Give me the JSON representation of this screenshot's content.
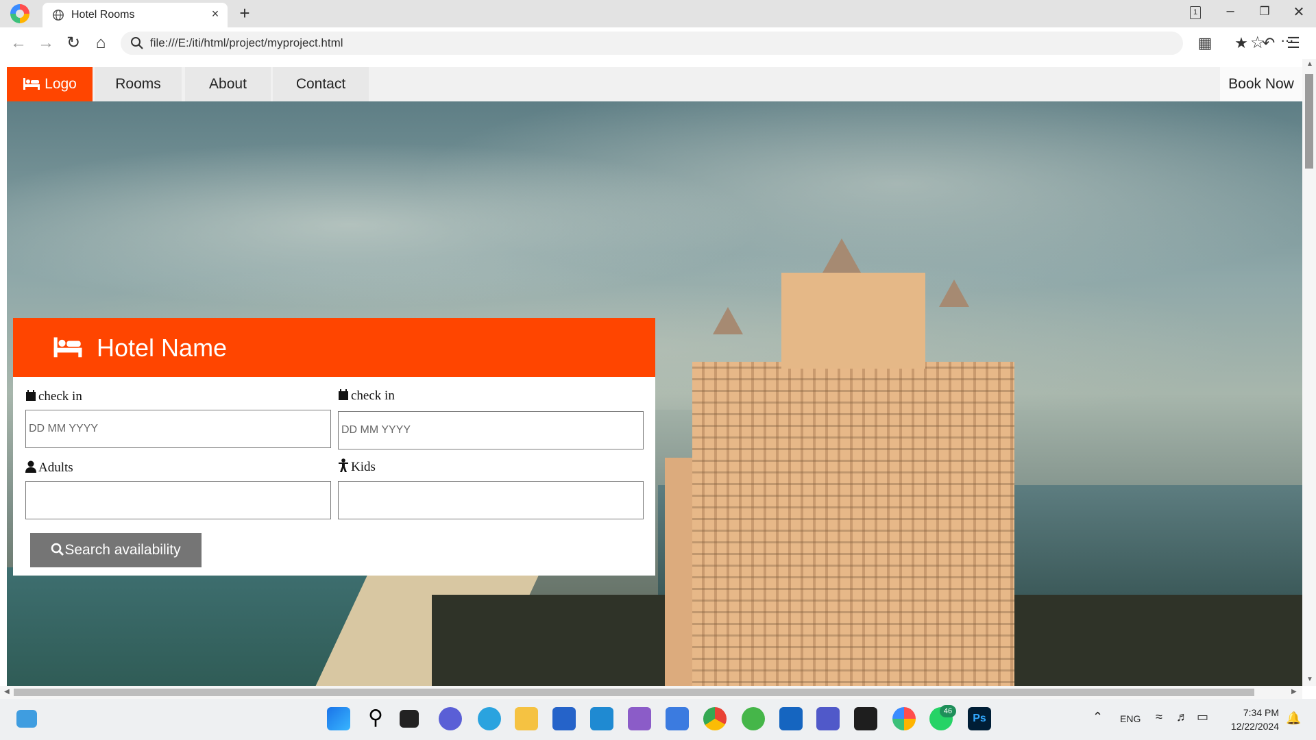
{
  "browser": {
    "tab_title": "Hotel Rooms",
    "tab_close": "×",
    "new_tab": "+",
    "url": "file:///E:/iti/html/project/myproject.html",
    "tab_count": "1"
  },
  "nav": {
    "logo": "Logo",
    "rooms": "Rooms",
    "about": "About",
    "contact": "Contact",
    "book_now": "Book Now"
  },
  "booking": {
    "title": "Hotel Name",
    "check_in_label_1": "check in",
    "check_in_label_2": "check in",
    "date_placeholder": "DD MM YYYY",
    "adults_label": "Adults",
    "kids_label": "Kids",
    "search_button": "Search availability"
  },
  "colors": {
    "brand": "#ff4500",
    "button": "#757575"
  },
  "taskbar": {
    "lang": "ENG",
    "time": "7:34 PM",
    "date": "12/22/2024",
    "whatsapp_badge": "46"
  }
}
